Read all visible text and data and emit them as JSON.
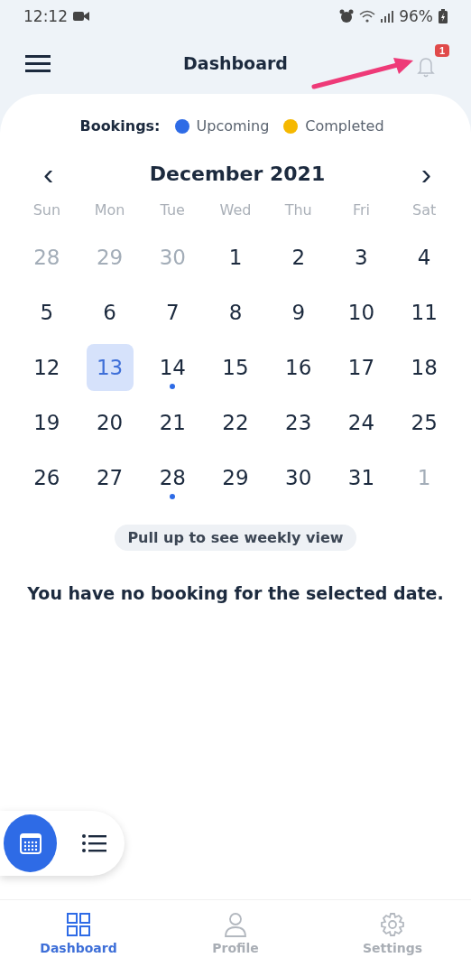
{
  "status_bar": {
    "time": "12:12",
    "battery": "96%"
  },
  "header": {
    "title": "Dashboard",
    "notification_count": "1"
  },
  "legend": {
    "label": "Bookings:",
    "items": [
      {
        "label": "Upcoming",
        "color": "#2e6be6"
      },
      {
        "label": "Completed",
        "color": "#f5b800"
      }
    ]
  },
  "calendar": {
    "month": "December 2021",
    "prev": "‹",
    "next": "›",
    "weekdays": [
      "Sun",
      "Mon",
      "Tue",
      "Wed",
      "Thu",
      "Fri",
      "Sat"
    ],
    "days": [
      {
        "day": "28",
        "outside": true,
        "selected": false,
        "booking": false
      },
      {
        "day": "29",
        "outside": true,
        "selected": false,
        "booking": false
      },
      {
        "day": "30",
        "outside": true,
        "selected": false,
        "booking": false
      },
      {
        "day": "1",
        "outside": false,
        "selected": false,
        "booking": false
      },
      {
        "day": "2",
        "outside": false,
        "selected": false,
        "booking": false
      },
      {
        "day": "3",
        "outside": false,
        "selected": false,
        "booking": false
      },
      {
        "day": "4",
        "outside": false,
        "selected": false,
        "booking": false
      },
      {
        "day": "5",
        "outside": false,
        "selected": false,
        "booking": false
      },
      {
        "day": "6",
        "outside": false,
        "selected": false,
        "booking": false
      },
      {
        "day": "7",
        "outside": false,
        "selected": false,
        "booking": false
      },
      {
        "day": "8",
        "outside": false,
        "selected": false,
        "booking": false
      },
      {
        "day": "9",
        "outside": false,
        "selected": false,
        "booking": false
      },
      {
        "day": "10",
        "outside": false,
        "selected": false,
        "booking": false
      },
      {
        "day": "11",
        "outside": false,
        "selected": false,
        "booking": false
      },
      {
        "day": "12",
        "outside": false,
        "selected": false,
        "booking": false
      },
      {
        "day": "13",
        "outside": false,
        "selected": true,
        "booking": false
      },
      {
        "day": "14",
        "outside": false,
        "selected": false,
        "booking": true
      },
      {
        "day": "15",
        "outside": false,
        "selected": false,
        "booking": false
      },
      {
        "day": "16",
        "outside": false,
        "selected": false,
        "booking": false
      },
      {
        "day": "17",
        "outside": false,
        "selected": false,
        "booking": false
      },
      {
        "day": "18",
        "outside": false,
        "selected": false,
        "booking": false
      },
      {
        "day": "19",
        "outside": false,
        "selected": false,
        "booking": false
      },
      {
        "day": "20",
        "outside": false,
        "selected": false,
        "booking": false
      },
      {
        "day": "21",
        "outside": false,
        "selected": false,
        "booking": false
      },
      {
        "day": "22",
        "outside": false,
        "selected": false,
        "booking": false
      },
      {
        "day": "23",
        "outside": false,
        "selected": false,
        "booking": false
      },
      {
        "day": "24",
        "outside": false,
        "selected": false,
        "booking": false
      },
      {
        "day": "25",
        "outside": false,
        "selected": false,
        "booking": false
      },
      {
        "day": "26",
        "outside": false,
        "selected": false,
        "booking": false
      },
      {
        "day": "27",
        "outside": false,
        "selected": false,
        "booking": false
      },
      {
        "day": "28",
        "outside": false,
        "selected": false,
        "booking": true
      },
      {
        "day": "29",
        "outside": false,
        "selected": false,
        "booking": false
      },
      {
        "day": "30",
        "outside": false,
        "selected": false,
        "booking": false
      },
      {
        "day": "31",
        "outside": false,
        "selected": false,
        "booking": false
      },
      {
        "day": "1",
        "outside": true,
        "selected": false,
        "booking": false
      }
    ],
    "hint": "Pull up to see weekly view"
  },
  "empty_message": "You have no booking for the selected date.",
  "view_toggle": [
    {
      "kind": "calendar",
      "selected": true
    },
    {
      "kind": "list",
      "selected": false
    }
  ],
  "bottom_nav": [
    {
      "kind": "dashboard",
      "label": "Dashboard",
      "selected": true
    },
    {
      "kind": "profile",
      "label": "Profile",
      "selected": false
    },
    {
      "kind": "settings",
      "label": "Settings",
      "selected": false
    }
  ]
}
